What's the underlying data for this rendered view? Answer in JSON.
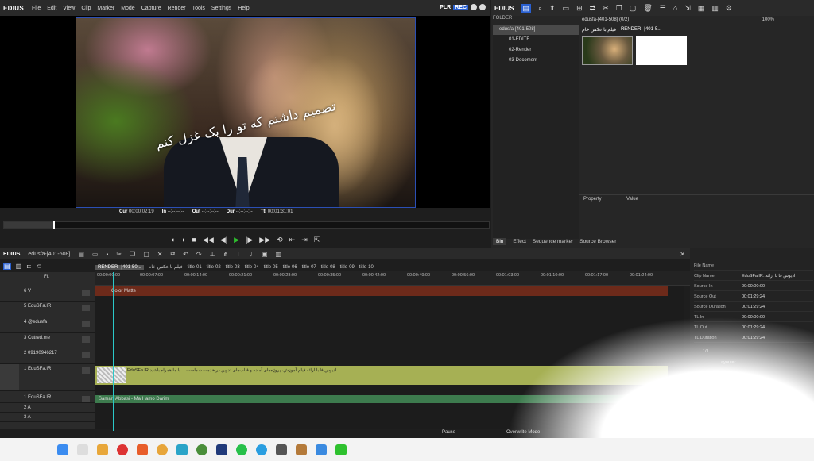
{
  "app": {
    "logo": "EDIUS",
    "plr": "PLR",
    "rec": "REC"
  },
  "menu": [
    "File",
    "Edit",
    "View",
    "Clip",
    "Marker",
    "Mode",
    "Capture",
    "Render",
    "Tools",
    "Settings",
    "Help"
  ],
  "preview": {
    "caption": "تصمیم داشتم که تو را یک غزل کنم",
    "cue": "00:00:02:19",
    "in": "--:--:--:--",
    "out": "--:--:--:--",
    "dur": "--:--:--:--",
    "ttl": "00:01:31:01",
    "labels": {
      "cue": "Cur",
      "in": "In",
      "out": "Out",
      "dur": "Dur",
      "ttl": "Ttl"
    }
  },
  "bin": {
    "logo": "EDIUS",
    "folder_label": "FOLDER",
    "root": "edusfa-[401-508]",
    "folders": [
      "01-EDITE",
      "02-Render",
      "03-Docoment"
    ],
    "path": "edusfa-[401-508] (0/2)",
    "zoom": "100%",
    "clips": [
      "فیلم با عکس خام",
      "RENDER--[401-5..."
    ],
    "prop_headers": [
      "Property",
      "Value"
    ],
    "tabs": [
      "Bin",
      "Effect",
      "Sequence marker",
      "Source Browser"
    ]
  },
  "timeline": {
    "logo": "EDIUS",
    "project": "edusfa-[401-508]",
    "fit": "Fit",
    "seq_tabs": [
      "RENDER--[401-50...",
      "فیلم با عکس خام",
      "title-01",
      "title-02",
      "title-03",
      "title-04",
      "title-05",
      "title-06",
      "title-07",
      "title-08",
      "title-09",
      "title-10"
    ],
    "ruler": [
      "00:00:00:00",
      "00:00:07:00",
      "00:00:14:00",
      "00:00:21:00",
      "00:00:28:00",
      "00:00:35:00",
      "00:00:42:00",
      "00:00:49:00",
      "00:00:56:00",
      "00:01:03:00",
      "00:01:10:00",
      "00:01:17:00",
      "00:01:24:00"
    ],
    "tracks": [
      "6 V",
      "5 EduSFa.IR",
      "4 @edusfa",
      "3 Cutred.me",
      "2 09190946217",
      "1 EduSFa.IR",
      "1 EduSFa.IR",
      "2 A",
      "3 A"
    ],
    "clip_colormatte": "Color Matte",
    "clip_main": "EduSFa.IR ادیوس فا با ارائه فیلم آموزش، پروژه‌های آماده و قالب‌های تدوین در خدمت شماست ... با ما همراه باشید",
    "clip_audio": "Samar_Abbasi - Ma Hamo Darim",
    "status_left": "Pause",
    "status_mid": "Overwrite Mode"
  },
  "info": {
    "rows": [
      [
        "File Name",
        ""
      ],
      [
        "Clip Name",
        "EduSFa.IR::ادیوس فا با ارائه"
      ],
      [
        "Source In",
        "00:00:00:00"
      ],
      [
        "Source Out",
        "00:01:29:24"
      ],
      [
        "Source Duration",
        "00:01:29:24"
      ],
      [
        "TL In",
        "00:00:00:00"
      ],
      [
        "TL Out",
        "00:01:29:24"
      ],
      [
        "TL Duration",
        "00:01:29:24"
      ]
    ],
    "page": "1/1",
    "layouter": "Layouter"
  },
  "colors": {
    "accent": "#2a60d0",
    "matte": "#6d2a1a",
    "main_clip": "#a6b054",
    "audio": "#3d7b4e"
  }
}
